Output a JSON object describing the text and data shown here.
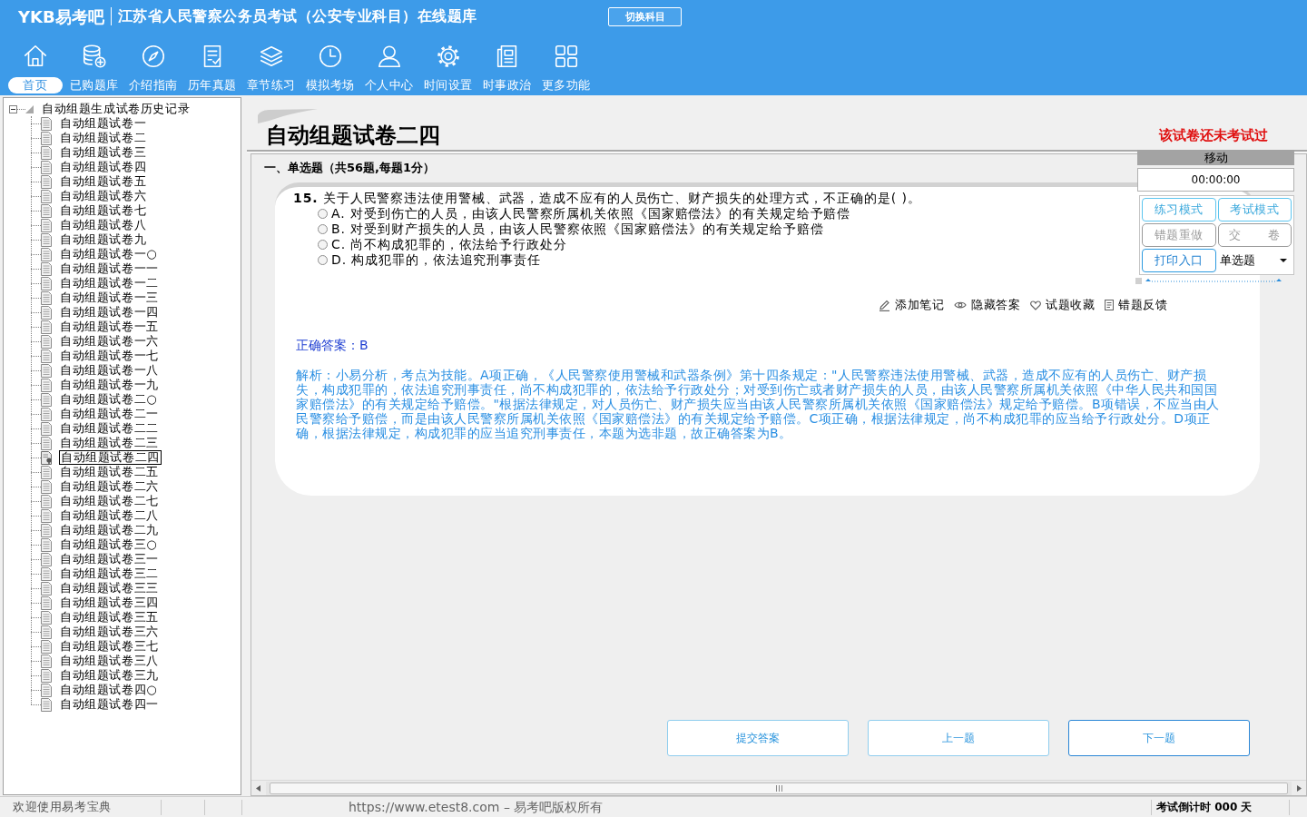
{
  "header": {
    "logo": "YKB易考吧",
    "title": "江苏省人民警察公务员考试（公安专业科目）在线题库",
    "switch_button": "切换科目"
  },
  "nav": [
    {
      "label": "首页",
      "selected": true
    },
    {
      "label": "已购题库",
      "selected": false
    },
    {
      "label": "介绍指南",
      "selected": false
    },
    {
      "label": "历年真题",
      "selected": false
    },
    {
      "label": "章节练习",
      "selected": false
    },
    {
      "label": "模拟考场",
      "selected": false
    },
    {
      "label": "个人中心",
      "selected": false
    },
    {
      "label": "时间设置",
      "selected": false
    },
    {
      "label": "时事政治",
      "selected": false
    },
    {
      "label": "更多功能",
      "selected": false
    }
  ],
  "sidebar": {
    "tree": {
      "label": "自动组题生成试卷历史记录",
      "expanded": true,
      "children": [
        {
          "label": "自动组题试卷一",
          "selected": false
        },
        {
          "label": "自动组题试卷二",
          "selected": false
        },
        {
          "label": "自动组题试卷三",
          "selected": false
        },
        {
          "label": "自动组题试卷四",
          "selected": false
        },
        {
          "label": "自动组题试卷五",
          "selected": false
        },
        {
          "label": "自动组题试卷六",
          "selected": false
        },
        {
          "label": "自动组题试卷七",
          "selected": false
        },
        {
          "label": "自动组题试卷八",
          "selected": false
        },
        {
          "label": "自动组题试卷九",
          "selected": false
        },
        {
          "label": "自动组题试卷一○",
          "selected": false
        },
        {
          "label": "自动组题试卷一一",
          "selected": false
        },
        {
          "label": "自动组题试卷一二",
          "selected": false
        },
        {
          "label": "自动组题试卷一三",
          "selected": false
        },
        {
          "label": "自动组题试卷一四",
          "selected": false
        },
        {
          "label": "自动组题试卷一五",
          "selected": false
        },
        {
          "label": "自动组题试卷一六",
          "selected": false
        },
        {
          "label": "自动组题试卷一七",
          "selected": false
        },
        {
          "label": "自动组题试卷一八",
          "selected": false
        },
        {
          "label": "自动组题试卷一九",
          "selected": false
        },
        {
          "label": "自动组题试卷二○",
          "selected": false
        },
        {
          "label": "自动组题试卷二一",
          "selected": false
        },
        {
          "label": "自动组题试卷二二",
          "selected": false
        },
        {
          "label": "自动组题试卷二三",
          "selected": false
        },
        {
          "label": "自动组题试卷二四",
          "selected": true
        },
        {
          "label": "自动组题试卷二五",
          "selected": false
        },
        {
          "label": "自动组题试卷二六",
          "selected": false
        },
        {
          "label": "自动组题试卷二七",
          "selected": false
        },
        {
          "label": "自动组题试卷二八",
          "selected": false
        },
        {
          "label": "自动组题试卷二九",
          "selected": false
        },
        {
          "label": "自动组题试卷三○",
          "selected": false
        },
        {
          "label": "自动组题试卷三一",
          "selected": false
        },
        {
          "label": "自动组题试卷三二",
          "selected": false
        },
        {
          "label": "自动组题试卷三三",
          "selected": false
        },
        {
          "label": "自动组题试卷三四",
          "selected": false
        },
        {
          "label": "自动组题试卷三五",
          "selected": false
        },
        {
          "label": "自动组题试卷三六",
          "selected": false
        },
        {
          "label": "自动组题试卷三七",
          "selected": false
        },
        {
          "label": "自动组题试卷三八",
          "selected": false
        },
        {
          "label": "自动组题试卷三九",
          "selected": false
        },
        {
          "label": "自动组题试卷四○",
          "selected": false
        },
        {
          "label": "自动组题试卷四一",
          "selected": false
        }
      ]
    }
  },
  "exam": {
    "title": "自动组题试卷二四",
    "status": "该试卷还未考试过",
    "section": "一、单选题（共56题,每题1分）",
    "question": {
      "text": "**15.** 关于人民警察违法使用警械、武器，造成不应有的人员伤亡、财产损失的处理方式，不正确的是( )。",
      "options": [
        {
          "text": "A. 对受到伤亡的人员，由该人民警察所属机关依照《国家赔偿法》的有关规定给予赔偿",
          "selected": false
        },
        {
          "text": "B. 对受到财产损失的人员，由该人民警察依照《国家赔偿法》的有关规定给予赔偿",
          "selected": false
        },
        {
          "text": "C. 尚不构成犯罪的，依法给予行政处分",
          "selected": false
        },
        {
          "text": "D. 构成犯罪的，依法追究刑事责任",
          "selected": false
        }
      ]
    },
    "actions": [
      {
        "label": "添加笔记"
      },
      {
        "label": "隐藏答案"
      },
      {
        "label": "试题收藏"
      },
      {
        "label": "错题反馈"
      }
    ],
    "answer": "正确答案：B",
    "analysis": "解析：小易分析，考点为技能。A项正确，《人民警察使用警械和武器条例》第十四条规定：\"人民警察违法使用警械、武器，造成不应有的人员伤亡、财产损失，构成犯罪的，依法追究刑事责任，尚不构成犯罪的，依法给予行政处分；对受到伤亡或者财产损失的人员，由该人民警察所属机关依照《中华人民共和国国家赔偿法》的有关规定给予赔偿。\"根据法律规定，对人员伤亡、财产损失应当由该人民警察所属机关依照《国家赔偿法》规定给予赔偿。B项错误，不应当由人民警察给予赔偿，而是由该人民警察所属机关依照《国家赔偿法》的有关规定给予赔偿。C项正确，根据法律规定，尚不构成犯罪的应当给予行政处分。D项正确，根据法律规定，构成犯罪的应当追究刑事责任，本题为选非题，故正确答案为B。"
  },
  "float_panel": {
    "title": "移动",
    "timer": "00:00:00",
    "buttons": [
      {
        "label": "练习模式",
        "kind": "mode",
        "disabled": false
      },
      {
        "label": "考试模式",
        "kind": "mode",
        "disabled": false
      },
      {
        "label": "错题重做",
        "kind": "action",
        "disabled": true
      },
      {
        "label": "交 卷",
        "kind": "action",
        "disabled": true
      },
      {
        "label": "打印入口",
        "kind": "print",
        "disabled": false
      }
    ],
    "dropdown": "单选题"
  },
  "footer_buttons": [
    {
      "label": "提交答案",
      "focused": false
    },
    {
      "label": "上一题",
      "focused": false
    },
    {
      "label": "下一题",
      "focused": true
    }
  ],
  "status_bar": {
    "welcome": "欢迎使用易考宝典",
    "copyright": "https://www.etest8.com – 易考吧版权所有",
    "countdown": "考试倒计时 000 天"
  }
}
